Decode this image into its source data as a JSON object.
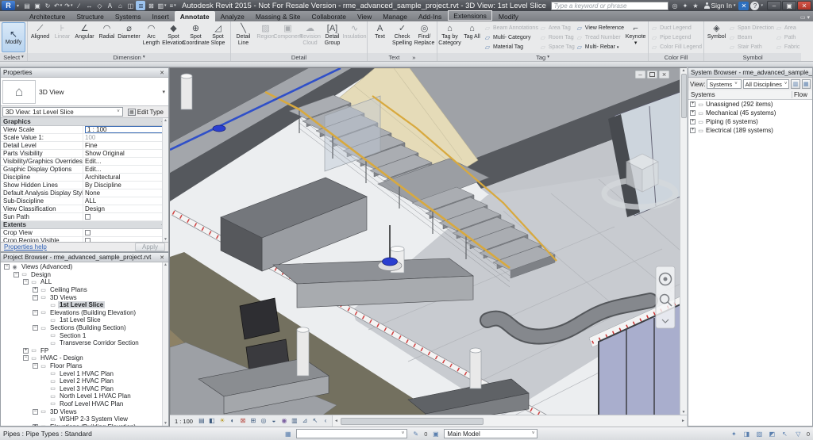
{
  "titlebar": {
    "title": "Autodesk Revit 2015 - Not For Resale Version -    rme_advanced_sample_project.rvt - 3D View: 1st Level Slice",
    "logo": "R",
    "search_placeholder": "Type a keyword or phrase",
    "signin_label": "Sign In",
    "qat_icons": [
      {
        "name": "open",
        "g": "▤"
      },
      {
        "name": "save",
        "g": "▣"
      },
      {
        "name": "sync-with-central",
        "g": "↻"
      },
      {
        "name": "undo",
        "g": "↶",
        "arrow": true
      },
      {
        "name": "redo",
        "g": "↷",
        "arrow": true
      },
      {
        "name": "measure",
        "g": "∕"
      },
      {
        "name": "aligned-dimension",
        "g": "↔"
      },
      {
        "name": "tag-by-category",
        "g": "◇"
      },
      {
        "name": "text",
        "g": "A"
      },
      {
        "name": "default-3d-view",
        "g": "⌂"
      },
      {
        "name": "section",
        "g": "◫"
      },
      {
        "name": "thin-lines",
        "g": "≣",
        "active": true
      },
      {
        "name": "close-hidden-windows",
        "g": "⊠"
      },
      {
        "name": "switch-windows",
        "g": "▥",
        "arrow": true
      },
      {
        "name": "customize-quick-access",
        "g": "≡",
        "arrow": true
      }
    ],
    "right_icons": [
      {
        "name": "search",
        "g": "◎"
      },
      {
        "name": "communication-center",
        "g": "✦"
      },
      {
        "name": "favorites",
        "g": "★"
      }
    ],
    "exchange_glyph": "✕",
    "help_glyph": "?",
    "window_buttons": {
      "minimize": "–",
      "restore": "▣",
      "close": "✕"
    }
  },
  "tabs": [
    {
      "label": "Architecture"
    },
    {
      "label": "Structure"
    },
    {
      "label": "Systems"
    },
    {
      "label": "Insert"
    },
    {
      "label": "Annotate",
      "active": true
    },
    {
      "label": "Analyze"
    },
    {
      "label": "Massing & Site"
    },
    {
      "label": "Collaborate"
    },
    {
      "label": "View"
    },
    {
      "label": "Manage"
    },
    {
      "label": "Add-Ins"
    },
    {
      "label": "Extensions",
      "boxed": true
    },
    {
      "label": "Modify"
    }
  ],
  "ribbon": {
    "select": {
      "caption": "Select",
      "arrow": true,
      "modify": "Modify"
    },
    "dimension": {
      "caption": "Dimension",
      "arrow": true,
      "tools": [
        {
          "label": "Aligned",
          "g": "⟋"
        },
        {
          "label": "Linear",
          "g": "⊦",
          "dim": true
        },
        {
          "label": "Angular",
          "g": "∠"
        },
        {
          "label": "Radial",
          "g": "◠"
        },
        {
          "label": "Diameter",
          "g": "⌀"
        },
        {
          "label": "Arc Length",
          "g": "◠"
        },
        {
          "label": "Spot Elevation",
          "g": "◆"
        },
        {
          "label": "Spot Coordinate",
          "g": "⊕"
        },
        {
          "label": "Spot Slope",
          "g": "◿"
        }
      ]
    },
    "detail": {
      "caption": "Detail",
      "tools": [
        {
          "label": "Detail Line",
          "g": "╲"
        },
        {
          "label": "Region",
          "g": "▨",
          "dim": true
        },
        {
          "label": "Component",
          "g": "▣",
          "dim": true
        },
        {
          "label": "Revision Cloud",
          "g": "☁",
          "dim": true
        },
        {
          "label": "Detail Group",
          "g": "[A]"
        },
        {
          "label": "Insulation",
          "g": "∿",
          "dim": true
        }
      ]
    },
    "text": {
      "caption": "Text",
      "expander": "»",
      "tools": [
        {
          "label": "Text",
          "g": "A"
        },
        {
          "label": "Check Spelling",
          "g": "✓"
        },
        {
          "label": "Find/ Replace",
          "g": "◎"
        }
      ]
    },
    "tag": {
      "caption": "Tag",
      "arrow": true,
      "big": [
        {
          "label": "Tag by Category",
          "g": "⌂"
        },
        {
          "label": "Tag All",
          "g": "⌂"
        }
      ],
      "columns": [
        [
          {
            "label": "Beam Annotations",
            "dim": true
          },
          {
            "label": "Multi- Category"
          },
          {
            "label": "Material Tag"
          }
        ],
        [
          {
            "label": "Area Tag",
            "dim": true
          },
          {
            "label": "Room Tag",
            "dim": true
          },
          {
            "label": "Space Tag",
            "dim": true
          }
        ],
        [
          {
            "label": "View Reference"
          },
          {
            "label": "Tread Number",
            "dim": true
          },
          {
            "label": "Multi- Rebar",
            "arrow": true
          }
        ]
      ],
      "keynote": {
        "label": "Keynote",
        "g": "⌐",
        "arrow": true
      }
    },
    "colorfill": {
      "caption": "Color Fill",
      "items": [
        {
          "label": "Duct Legend",
          "dim": true
        },
        {
          "label": "Pipe Legend",
          "dim": true
        },
        {
          "label": "Color Fill Legend",
          "dim": true
        }
      ]
    },
    "symbol": {
      "caption": "Symbol",
      "big": {
        "label": "Symbol",
        "g": "◈"
      },
      "columns": [
        [
          {
            "label": "Span Direction",
            "dim": true
          },
          {
            "label": "Beam",
            "dim": true
          },
          {
            "label": "Stair Path",
            "dim": true
          }
        ],
        [
          {
            "label": "Area",
            "dim": true
          },
          {
            "label": "Path",
            "dim": true
          },
          {
            "label": "Fabric",
            "dim": true
          }
        ]
      ]
    }
  },
  "properties": {
    "title": "Properties",
    "close_glyph": "✕",
    "type_name": "3D View",
    "instance": "3D View: 1st Level Slice",
    "edit_type": "Edit Type",
    "sections": [
      {
        "header": "Graphics",
        "pin": "✳",
        "rows": [
          {
            "label": "View Scale",
            "value": "1 : 100",
            "kind": "input"
          },
          {
            "label": "Scale Value    1:",
            "value": "100",
            "kind": "disabled"
          },
          {
            "label": "Detail Level",
            "value": "Fine",
            "kind": "text"
          },
          {
            "label": "Parts Visibility",
            "value": "Show Original",
            "kind": "text"
          },
          {
            "label": "Visibility/Graphics Overrides",
            "value": "Edit...",
            "kind": "button"
          },
          {
            "label": "Graphic Display Options",
            "value": "Edit...",
            "kind": "button"
          },
          {
            "label": "Discipline",
            "value": "Architectural",
            "kind": "text"
          },
          {
            "label": "Show Hidden Lines",
            "value": "By Discipline",
            "kind": "text"
          },
          {
            "label": "Default Analysis Display Style",
            "value": "None",
            "kind": "text"
          },
          {
            "label": "Sub-Discipline",
            "value": "ALL",
            "kind": "text"
          },
          {
            "label": "View Classification",
            "value": "Design",
            "kind": "text"
          },
          {
            "label": "Sun Path",
            "value": "",
            "kind": "checkbox"
          }
        ]
      },
      {
        "header": "Extents",
        "pin": "✳",
        "rows": [
          {
            "label": "Crop View",
            "value": "",
            "kind": "checkbox"
          },
          {
            "label": "Crop Region Visible",
            "value": "",
            "kind": "checkbox"
          }
        ]
      }
    ],
    "help": "Properties help",
    "apply": "Apply"
  },
  "project_browser": {
    "title": "Project Browser - rme_advanced_sample_project.rvt",
    "close_glyph": "✕",
    "items": [
      {
        "label": "Views (Advanced)",
        "level": 0,
        "exp": "minus",
        "icon": "views"
      },
      {
        "label": "Design",
        "level": 1,
        "exp": "minus",
        "icon": "none"
      },
      {
        "label": "ALL",
        "level": 2,
        "exp": "minus",
        "icon": "none"
      },
      {
        "label": "Ceiling Plans",
        "level": 3,
        "exp": "plus",
        "icon": "none"
      },
      {
        "label": "3D Views",
        "level": 3,
        "exp": "minus",
        "icon": "none"
      },
      {
        "label": "1st Level Slice",
        "level": 4,
        "exp": "none",
        "icon": "none",
        "selected": true
      },
      {
        "label": "Elevations (Building Elevation)",
        "level": 3,
        "exp": "minus",
        "icon": "none"
      },
      {
        "label": "1st Level Slice",
        "level": 4,
        "exp": "none",
        "icon": "none"
      },
      {
        "label": "Sections (Building Section)",
        "level": 3,
        "exp": "minus",
        "icon": "none"
      },
      {
        "label": "Section 1",
        "level": 4,
        "exp": "none",
        "icon": "none"
      },
      {
        "label": "Transverse Corridor Section",
        "level": 4,
        "exp": "none",
        "icon": "none"
      },
      {
        "label": "FP",
        "level": 2,
        "exp": "plus",
        "icon": "none"
      },
      {
        "label": "HVAC - Design",
        "level": 2,
        "exp": "minus",
        "icon": "none"
      },
      {
        "label": "Floor Plans",
        "level": 3,
        "exp": "minus",
        "icon": "none"
      },
      {
        "label": "Level 1 HVAC Plan",
        "level": 4,
        "exp": "none",
        "icon": "none"
      },
      {
        "label": "Level 2 HVAC Plan",
        "level": 4,
        "exp": "none",
        "icon": "none"
      },
      {
        "label": "Level 3 HVAC Plan",
        "level": 4,
        "exp": "none",
        "icon": "none"
      },
      {
        "label": "North Level 1 HVAC Plan",
        "level": 4,
        "exp": "none",
        "icon": "none"
      },
      {
        "label": "Roof Level HVAC Plan",
        "level": 4,
        "exp": "none",
        "icon": "none"
      },
      {
        "label": "3D Views",
        "level": 3,
        "exp": "minus",
        "icon": "none"
      },
      {
        "label": "WSHP 2-3 System View",
        "level": 4,
        "exp": "none",
        "icon": "none"
      },
      {
        "label": "Elevations (Building Elevation)",
        "level": 3,
        "exp": "plus",
        "icon": "none"
      }
    ]
  },
  "system_browser": {
    "title": "System Browser - rme_advanced_sample_project.rvt",
    "close_glyph": "✕",
    "view_label": "View:",
    "dropdown1": "Systems",
    "dropdown2": "All Disciplines",
    "columns": [
      "Systems",
      "Flow"
    ],
    "rows": [
      {
        "label": "Unassigned (292 items)"
      },
      {
        "label": "Mechanical (45 systems)"
      },
      {
        "label": "Piping (6 systems)"
      },
      {
        "label": "Electrical (189 systems)"
      }
    ]
  },
  "viewport": {
    "scale": "1 : 100",
    "window_buttons": {
      "minimize": "–",
      "restore": "▣",
      "close": "✕"
    },
    "vcb_icons": [
      {
        "name": "detail-level",
        "g": "▤"
      },
      {
        "name": "visual-style",
        "g": "◧"
      },
      {
        "name": "sun-path",
        "g": "☀",
        "c": "#b99a27"
      },
      {
        "name": "shadows",
        "g": "◐"
      },
      {
        "name": "crop-view",
        "g": "⊠",
        "c": "#b5443c"
      },
      {
        "name": "show-crop-region",
        "g": "⊞"
      },
      {
        "name": "unlocked-3d-view",
        "g": "◎"
      },
      {
        "name": "temporary-hide-isolate",
        "g": "◒"
      },
      {
        "name": "reveal-hidden-elements",
        "g": "◉",
        "c": "#7a5fa0"
      },
      {
        "name": "temporary-view-properties",
        "g": "▥"
      },
      {
        "name": "hide-analytical-model",
        "g": "⊿"
      },
      {
        "name": "displacement-sets",
        "g": "↖"
      },
      {
        "name": "collapse",
        "g": "‹"
      }
    ]
  },
  "statusbar": {
    "left_text": "Pipes : Pipe Types : Standard",
    "worksets_glyph": "▦",
    "workset_value": "",
    "editable_glyph": "✎",
    "editable_count": "0",
    "design_options_glyph": "▣",
    "main_model": "Main Model",
    "right_icons": [
      {
        "name": "worksharing-display",
        "g": "✦"
      },
      {
        "name": "exclude-options",
        "g": "◨"
      },
      {
        "name": "press-drag",
        "g": "▧"
      },
      {
        "name": "pin-toggle",
        "g": "◩"
      },
      {
        "name": "select-cursor",
        "g": "↖"
      }
    ],
    "filter_glyph": "▽",
    "filter_count": "0"
  }
}
